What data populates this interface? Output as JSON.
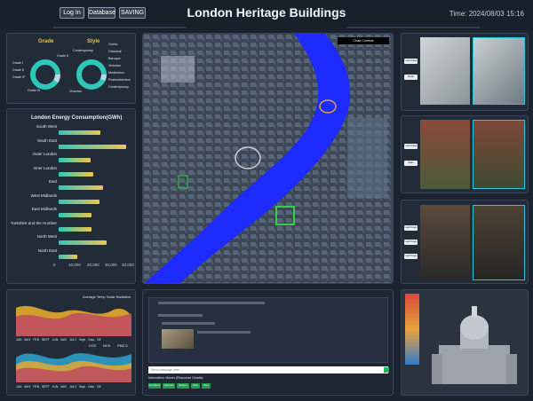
{
  "header": {
    "buttons": [
      "Log In",
      "Database",
      "SAVING"
    ],
    "title": "London Heritage Buildings",
    "time": "Time: 2024/08/03 15:16"
  },
  "grade_style": {
    "grade_title": "Grade",
    "style_title": "Style",
    "grade_labels": [
      "Grade I",
      "Grade II",
      "Grade II*",
      "Grade III"
    ],
    "style_labels": [
      "Contemporary",
      "Victorian"
    ],
    "style_legend": [
      "Gothic",
      "Classical",
      "Baroque",
      "Victorian",
      "Modernism",
      "Postmodernism",
      "Contemporary"
    ]
  },
  "energy": {
    "title": "London Energy Consumption(GWh)",
    "x_ticks": [
      "0",
      "10,000",
      "20,000",
      "30,000",
      "40,000"
    ]
  },
  "map": {
    "close_label": "Close Controls"
  },
  "images": {
    "buttons": [
      [
        "Load Image",
        "Model Predict"
      ],
      [
        "Load Image",
        "Make Predict"
      ],
      [
        "Load Image",
        "Load Image",
        "Load Image"
      ]
    ]
  },
  "weather": {
    "legend_top": [
      "Average Temp",
      "Solar Radiation"
    ],
    "legend_bottom": [
      "CO2",
      "NH3",
      "PM2.5"
    ],
    "months": [
      "JAN",
      "MAY",
      "FEB",
      "SEPT",
      "JUN",
      "MAY",
      "JULY",
      "Sept",
      "Octo",
      "DE",
      "DE"
    ]
  },
  "chat": {
    "placeholder": "Send message here...",
    "footer": "Information Viewer (Response Details)",
    "buttons": [
      "Gen Recon",
      "Generate",
      "Restore",
      "Pass",
      "Next"
    ]
  },
  "chart_data": {
    "type": "bar",
    "title": "London Energy Consumption(GWh)",
    "categories": [
      "South West",
      "South East",
      "Outer London",
      "Inner London",
      "East",
      "West Midlands",
      "East Midlands",
      "Yorkshire and the Humber",
      "North West",
      "North East"
    ],
    "values": [
      23000,
      37000,
      17500,
      19000,
      24500,
      22500,
      18000,
      18000,
      26500,
      10000
    ],
    "xlim": [
      0,
      40000
    ],
    "colors": [
      "#2ec8b8",
      "#f1c44d"
    ]
  }
}
